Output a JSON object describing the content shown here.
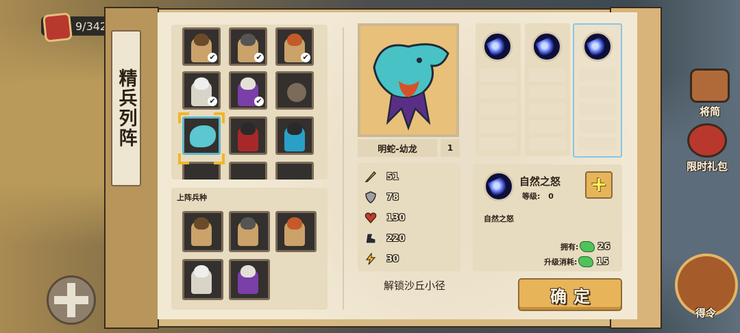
{
  "hud": {
    "counter": "9/342"
  },
  "side_buttons": {
    "scroll_label": "将简",
    "gift_label": "限时礼包",
    "order_label": "得令"
  },
  "panel": {
    "title": "精兵列阵"
  },
  "roster": {
    "units": [
      {
        "icon": "warrior-brown-icon",
        "deployed": true
      },
      {
        "icon": "warrior-gray-icon",
        "deployed": true
      },
      {
        "icon": "warrior-red-hair-icon",
        "deployed": true
      },
      {
        "icon": "monk-white-icon",
        "deployed": true
      },
      {
        "icon": "mage-purple-icon",
        "deployed": true
      },
      {
        "icon": "cannon-icon",
        "deployed": false
      },
      {
        "icon": "cyan-dragon-icon",
        "deployed": false,
        "selected": true
      },
      {
        "icon": "red-knight-icon",
        "deployed": false
      },
      {
        "icon": "cyan-knight-icon",
        "deployed": false
      }
    ],
    "check_mark": "✔"
  },
  "deploy": {
    "title": "上阵兵种",
    "units": [
      "warrior-brown-icon",
      "warrior-gray-icon",
      "warrior-red-hair-icon",
      "monk-white-icon",
      "mage-purple-icon"
    ]
  },
  "unit_detail": {
    "name": "明蛇-幼龙",
    "level": "1",
    "stats": [
      {
        "icon": "sword-icon",
        "value": "51"
      },
      {
        "icon": "shield-icon",
        "value": "78"
      },
      {
        "icon": "heart-icon",
        "value": "130"
      },
      {
        "icon": "speed-boot-icon",
        "value": "220"
      },
      {
        "icon": "lightning-icon",
        "value": "30"
      }
    ],
    "unlock_text": "解锁沙丘小径"
  },
  "skill": {
    "name": "自然之怒",
    "level_label": "等级:",
    "level_value": "0",
    "description": "自然之怒",
    "own_label": "拥有:",
    "own_value": "26",
    "cost_label": "升级消耗:",
    "cost_value": "15",
    "plus": "+"
  },
  "confirm_label": "确定",
  "colors": {
    "accent": "#e7b45a",
    "paper": "#f2e9d5",
    "selected_outline": "#86c6e8"
  }
}
